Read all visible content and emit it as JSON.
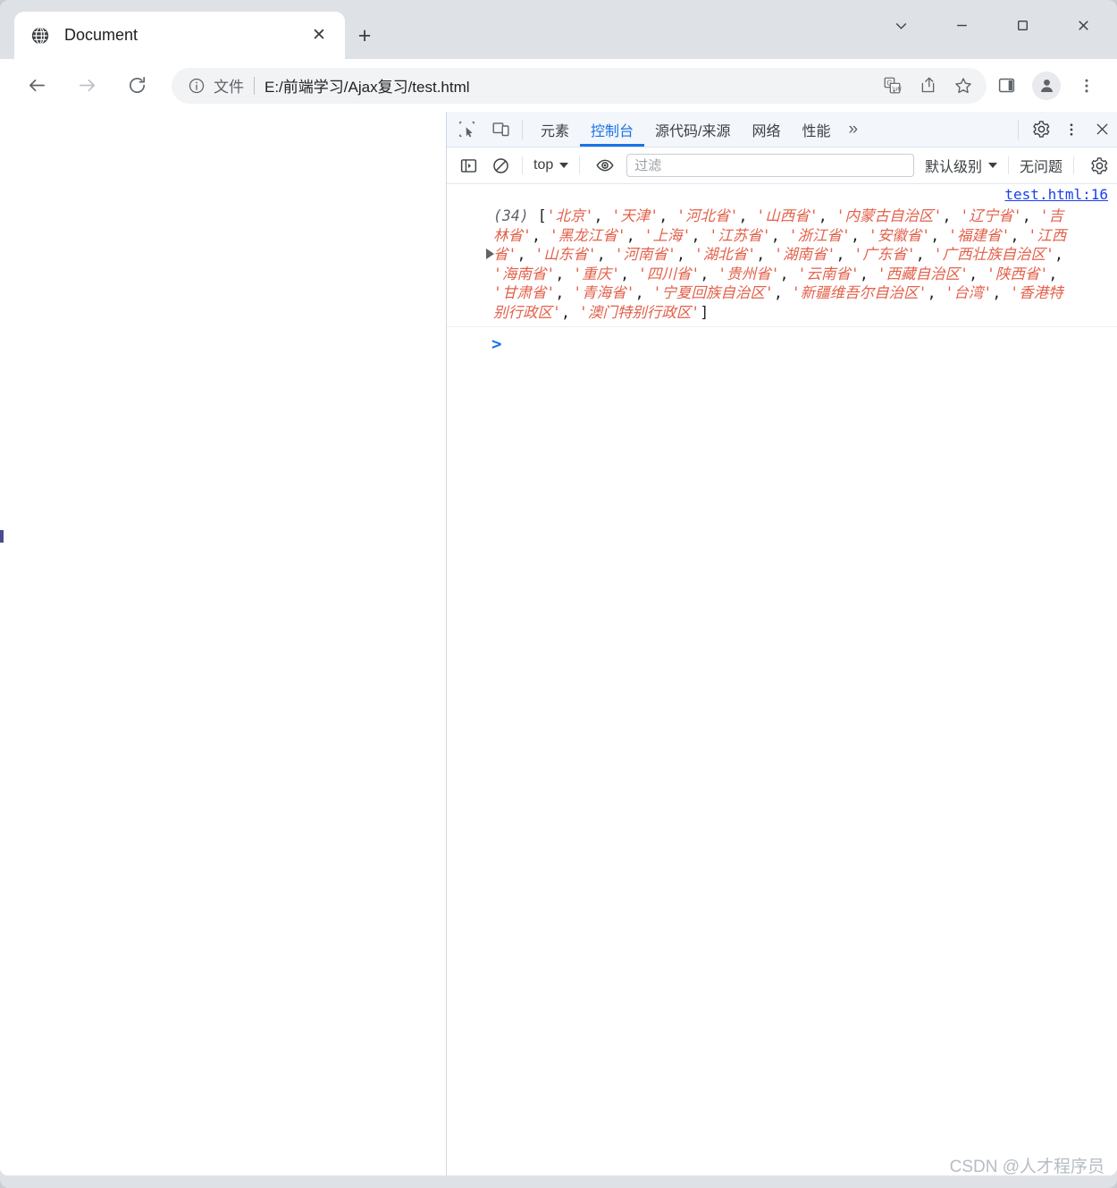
{
  "window": {
    "controls": [
      {
        "name": "chevron-down-icon",
        "label": "∨"
      },
      {
        "name": "minimize-icon",
        "label": "—"
      },
      {
        "name": "maximize-icon",
        "label": "□"
      },
      {
        "name": "close-icon",
        "label": "✕"
      }
    ]
  },
  "tab": {
    "title": "Document",
    "close_label": "✕",
    "newtab_label": "+"
  },
  "omnibox": {
    "scheme_label": "文件",
    "separator": "|",
    "url": "E:/前端学习/Ajax复习/test.html",
    "info_icon": "info-circle-icon"
  },
  "toolbar_right": {
    "translate": "translate-icon",
    "share": "share-icon",
    "bookmark": "star-icon",
    "side_panel": "side-panel-icon",
    "profile": "profile-avatar-icon",
    "menu": "three-dot-menu-icon"
  },
  "devtools": {
    "tabs": [
      {
        "label": "元素",
        "active": false
      },
      {
        "label": "控制台",
        "active": true
      },
      {
        "label": "源代码/来源",
        "active": false
      },
      {
        "label": "网络",
        "active": false
      },
      {
        "label": "性能",
        "active": false
      }
    ],
    "more_label": "»",
    "filterbar": {
      "context_label": "top",
      "filter_placeholder": "过滤",
      "filter_value": "",
      "level_label": "默认级别",
      "issues_label": "无问题"
    }
  },
  "console": {
    "source_link": "test.html:16",
    "count_prefix": "(34)",
    "open_bracket": "[",
    "close_bracket": "]",
    "array": [
      "北京",
      "天津",
      "河北省",
      "山西省",
      "内蒙古自治区",
      "辽宁省",
      "吉林省",
      "黑龙江省",
      "上海",
      "江苏省",
      "浙江省",
      "安徽省",
      "福建省",
      "江西省",
      "山东省",
      "河南省",
      "湖北省",
      "湖南省",
      "广东省",
      "广西壮族自治区",
      "海南省",
      "重庆",
      "四川省",
      "贵州省",
      "云南省",
      "西藏自治区",
      "陕西省",
      "甘肃省",
      "青海省",
      "宁夏回族自治区",
      "新疆维吾尔自治区",
      "台湾",
      "香港特别行政区",
      "澳门特别行政区"
    ],
    "prompt_symbol": ">"
  },
  "watermark": "CSDN @人才程序员",
  "colors": {
    "accent": "#1a73e8",
    "console_string": "#e3604a",
    "link": "#1a3ff0",
    "chrome_bg": "#dee1e6"
  }
}
